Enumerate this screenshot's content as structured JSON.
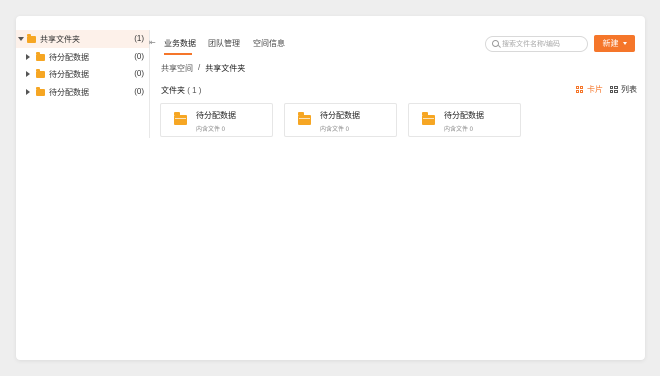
{
  "tree": {
    "root": {
      "label": "共享文件夹",
      "count": "(1)"
    },
    "children": [
      {
        "label": "待分配数据",
        "count": "(0)"
      },
      {
        "label": "待分配数据",
        "count": "(0)"
      },
      {
        "label": "待分配数据",
        "count": "(0)"
      }
    ]
  },
  "tabs": [
    {
      "label": "业务数据"
    },
    {
      "label": "团队管理"
    },
    {
      "label": "空间信息"
    }
  ],
  "search": {
    "placeholder": "搜索文件名称/编码"
  },
  "new_button": {
    "label": "新建"
  },
  "breadcrumb": {
    "parent": "共享空间",
    "separator": "/",
    "current": "共享文件夹"
  },
  "section": {
    "title": "文件夹",
    "count": "( 1 )"
  },
  "view": {
    "card_label": "卡片",
    "list_label": "列表"
  },
  "cards": [
    {
      "title": "待分配数据",
      "subtitle": "内含文件 0"
    },
    {
      "title": "待分配数据",
      "subtitle": "内含文件 0"
    },
    {
      "title": "待分配数据",
      "subtitle": "内含文件 0"
    }
  ],
  "colors": {
    "accent": "#f5762a",
    "folder": "#f6a623",
    "selected_row": "#fdf1ea"
  }
}
